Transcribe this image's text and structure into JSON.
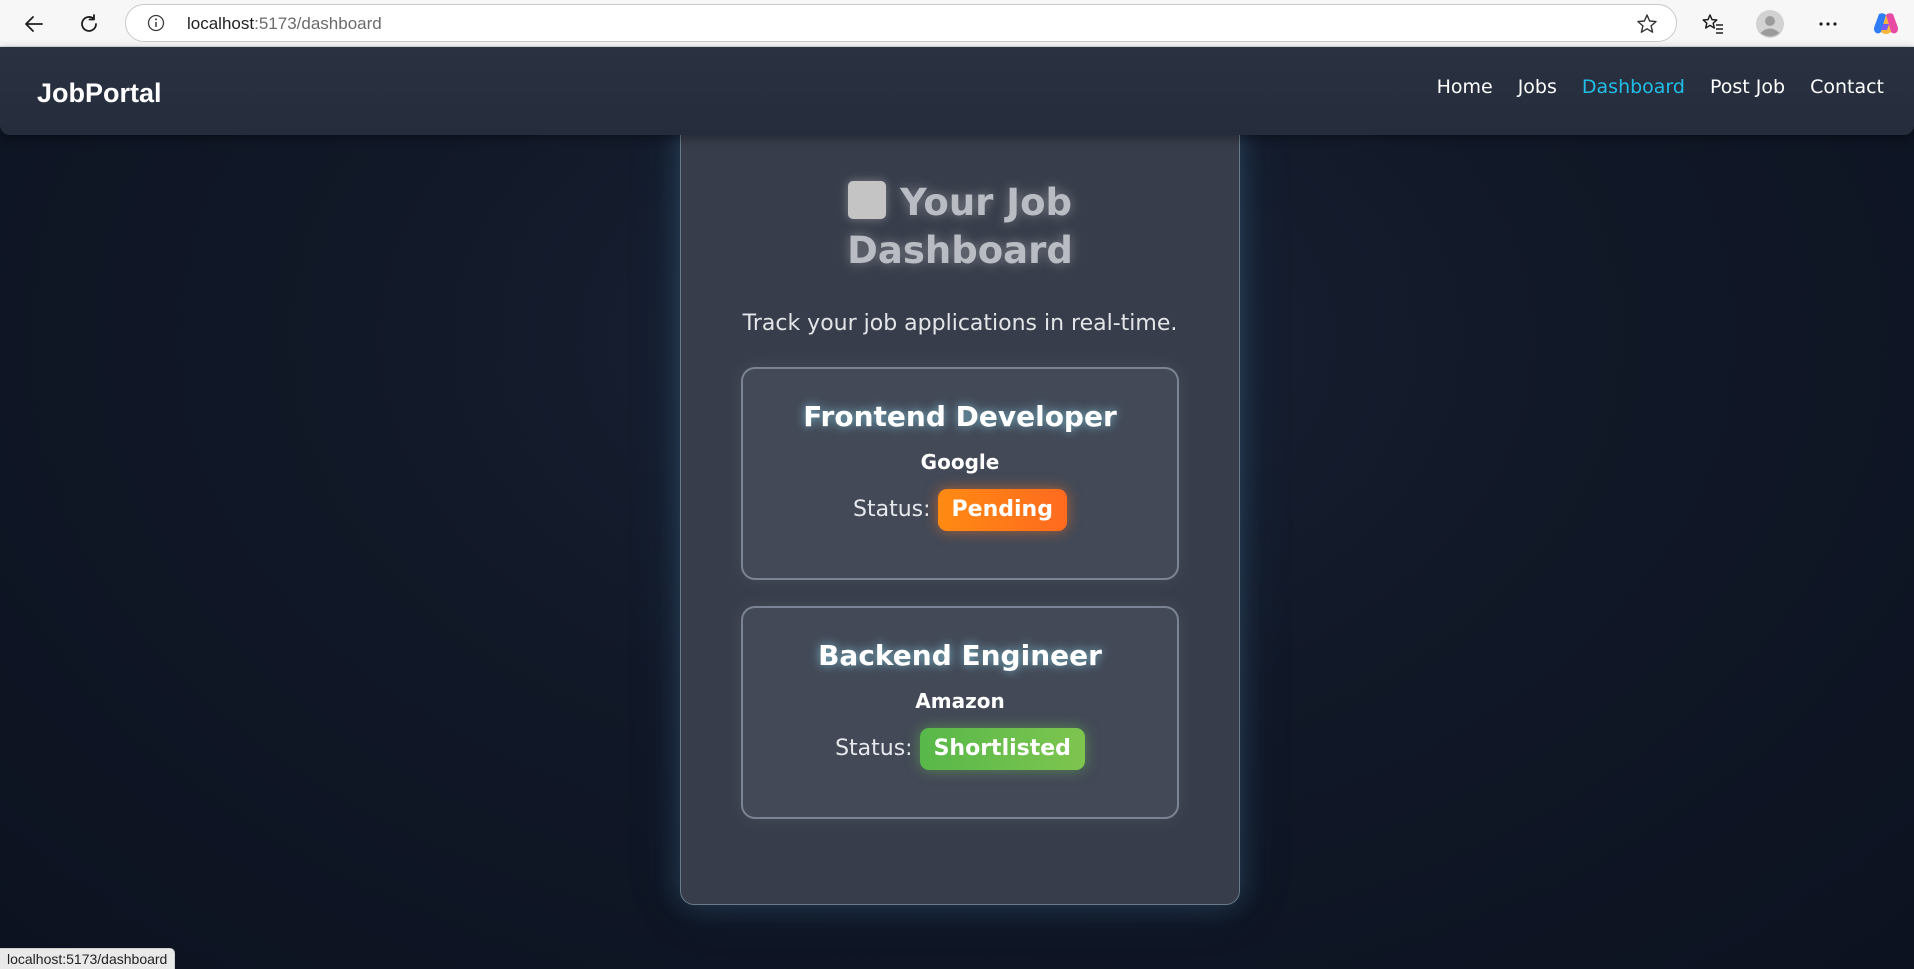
{
  "browser": {
    "url_host": "localhost",
    "url_path": ":5173/dashboard",
    "icons": [
      "back-icon",
      "reload-icon",
      "info-icon",
      "star-icon",
      "favorites-icon",
      "profile-icon",
      "more-icon",
      "copilot-icon"
    ]
  },
  "navbar": {
    "logo": "JobPortal",
    "links": [
      {
        "label": "Home"
      },
      {
        "label": "Jobs"
      },
      {
        "label": "Dashboard",
        "active": true
      },
      {
        "label": "Post Job"
      },
      {
        "label": "Contact"
      }
    ],
    "active_color": "#22bde6"
  },
  "dashboard": {
    "title_line1": "Your Job",
    "title_line2": "Dashboard",
    "subtitle": "Track your job applications in real-time.",
    "status_label": "Status:",
    "applications": [
      {
        "title": "Frontend Developer",
        "company": "Google",
        "status": "Pending",
        "status_color": "#ff7a18"
      },
      {
        "title": "Backend Engineer",
        "company": "Amazon",
        "status": "Shortlisted",
        "status_color": "#6abf4b"
      }
    ]
  },
  "statusbar": {
    "url": "localhost:5173/dashboard"
  }
}
